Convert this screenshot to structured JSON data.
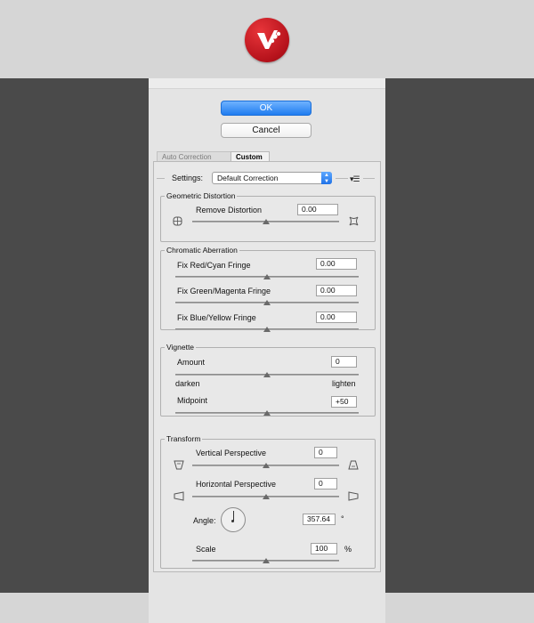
{
  "buttons": {
    "ok_label": "OK",
    "cancel_label": "Cancel"
  },
  "tabs": [
    {
      "label": "Auto Correction",
      "active": false
    },
    {
      "label": "Custom",
      "active": true
    }
  ],
  "settings": {
    "label": "Settings:",
    "selected": "Default Correction"
  },
  "geometric_distortion": {
    "title": "Geometric Distortion",
    "remove_distortion": {
      "label": "Remove Distortion",
      "value": "0.00",
      "slider_pct": 50
    }
  },
  "chromatic_aberration": {
    "title": "Chromatic Aberration",
    "items": [
      {
        "label": "Fix Red/Cyan Fringe",
        "value": "0.00",
        "slider_pct": 50
      },
      {
        "label": "Fix Green/Magenta Fringe",
        "value": "0.00",
        "slider_pct": 50
      },
      {
        "label": "Fix Blue/Yellow Fringe",
        "value": "0.00",
        "slider_pct": 50
      }
    ]
  },
  "vignette": {
    "title": "Vignette",
    "amount": {
      "label": "Amount",
      "value": "0",
      "slider_pct": 50
    },
    "darken_label": "darken",
    "lighten_label": "lighten",
    "midpoint": {
      "label": "Midpoint",
      "value": "+50",
      "slider_pct": 50
    }
  },
  "transform": {
    "title": "Transform",
    "vertical_perspective": {
      "label": "Vertical Perspective",
      "value": "0",
      "slider_pct": 50
    },
    "horizontal_perspective": {
      "label": "Horizontal Perspective",
      "value": "0",
      "slider_pct": 50
    },
    "angle": {
      "label": "Angle:",
      "value": "357.64",
      "unit": "°"
    },
    "scale": {
      "label": "Scale",
      "value": "100",
      "unit": "%",
      "slider_pct": 50
    }
  },
  "colors": {
    "accent": "#1f7cf0",
    "logo_red": "#c4161c",
    "backdrop": "#4a4a4a"
  }
}
